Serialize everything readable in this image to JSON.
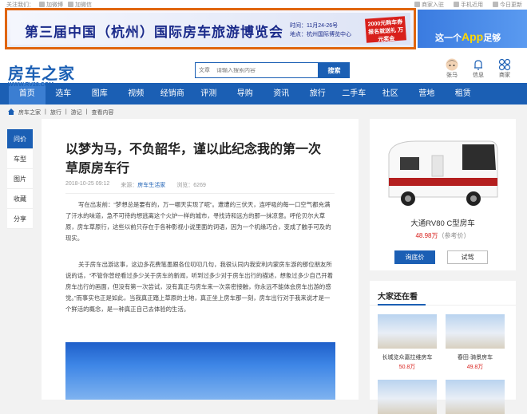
{
  "topbar": {
    "follow": "关注我们：",
    "weibo": "加微博",
    "weixin": "加微信",
    "dealer": "商家入驻",
    "mobile": "手机近用",
    "today": "今日更新"
  },
  "banner": {
    "title": "第三届中国（杭州）国际房车旅游博览会",
    "time": "时间：11月24-26号",
    "place": "地点：杭州国际博览中心",
    "promo": "2000元购车券 报名就送礼 万元奖金"
  },
  "ad_right": {
    "text_before": "这一个",
    "app": "App",
    "text_after": "足够"
  },
  "header": {
    "logo": "房车之家",
    "url": "WWW.RV28.COM",
    "search_category": "文章",
    "search_placeholder": "请输入搜索内容",
    "search_button": "搜索",
    "icons": [
      {
        "label": "张马"
      },
      {
        "label": "信息"
      },
      {
        "label": "商家"
      }
    ]
  },
  "nav": [
    "首页",
    "选车",
    "图库",
    "视频",
    "经销商",
    "评测",
    "导购",
    "资讯",
    "旅行",
    "二手车",
    "社区",
    "营地",
    "租赁"
  ],
  "breadcrumb": [
    "房车之家",
    "旅行",
    "游记",
    "查看内容"
  ],
  "side": [
    "问价",
    "车型",
    "图片",
    "收藏",
    "分享"
  ],
  "article": {
    "title": "以梦为马，不负韶华，谨以此纪念我的第一次草原房车行",
    "date": "2018-10-25 09:12",
    "source_label": "来源：",
    "source": "房车生活家",
    "views": "浏览：6269",
    "p1": "写在出发前：“梦想总是要有的，万一哪天实现了呢”。遭遭的三伏天，连呼吸的每一口空气都充满了汗水的味道，急不可待的想逃离这个火炉一样的城市，寻找诗和远方的那一抹凉意。呼伦贝尔大草原，房车草原行，这些以前只存在于各种影视小说里面的词语，因为一个机缘巧合，变成了触手可及的现实。",
    "p2": "关于房车出游这事，这边多花费笔墨跟各位叨叨几句，我很认同内我安利内蒙房车游的那位朋友所说的话，“不管你曾经看过多少关于房车的新闻，听到过多少对于房车出行的描述，想象过多少自己开着房车出行的画面，但没有第一次尝试，没有真正与房车来一次亲密接触，你永远不能体会房车出游的感觉。”而事实也正是如此，当我真正踏上草原的土地，真正坐上房车那一刻，房车出行对于我来说才是一个鲜活的概念，是一种真正自己去体验的生活。"
  },
  "featured": {
    "name": "大通RV80 C型房车",
    "price": "48.98万",
    "price_note": "（参考价）",
    "ask_button": "询底价",
    "test_button": "试驾"
  },
  "watching": {
    "title": "大家还在看",
    "items": [
      {
        "name": "长城览众嘉拉维房车",
        "price": "50.8万"
      },
      {
        "name": "春田·骑景房车",
        "price": "49.8万"
      }
    ]
  },
  "colors": {
    "brand": "#1b5fb4",
    "price": "#d8201c",
    "banner_border": "#e0650e"
  }
}
